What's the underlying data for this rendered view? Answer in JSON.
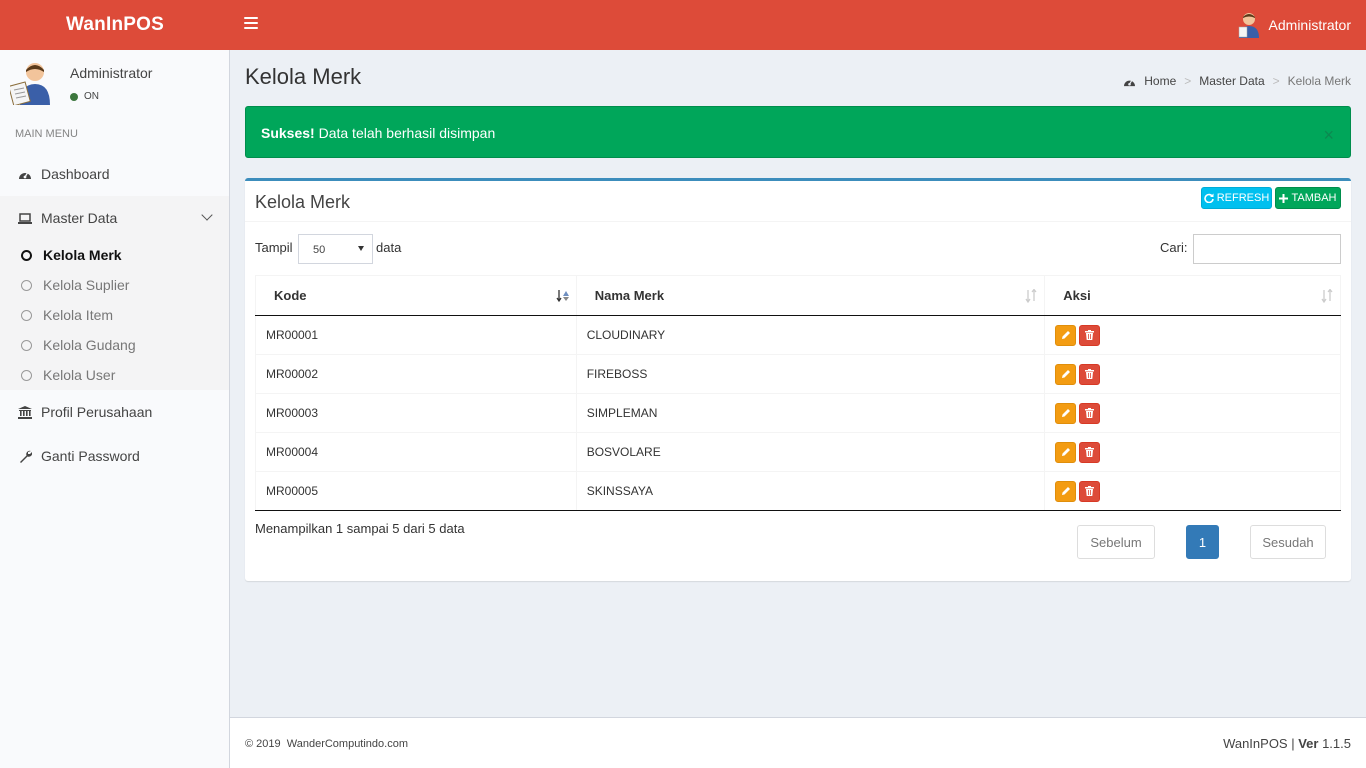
{
  "app": {
    "name": "WanInPOS"
  },
  "topbar": {
    "user_name": "Administrator"
  },
  "sidebar": {
    "user_name": "Administrator",
    "status": "ON",
    "menu_header": "MAIN MENU",
    "items": [
      {
        "label": "Dashboard",
        "icon": "dashboard-icon"
      },
      {
        "label": "Master Data",
        "icon": "laptop-icon"
      },
      {
        "label": "Profil Perusahaan",
        "icon": "bank-icon"
      },
      {
        "label": "Ganti Password",
        "icon": "wrench-icon"
      }
    ],
    "submenu": [
      {
        "label": "Kelola Merk",
        "current": true
      },
      {
        "label": "Kelola Suplier",
        "current": false
      },
      {
        "label": "Kelola Item",
        "current": false
      },
      {
        "label": "Kelola Gudang",
        "current": false
      },
      {
        "label": "Kelola User",
        "current": false
      }
    ]
  },
  "page": {
    "title": "Kelola Merk",
    "breadcrumb": [
      "Home",
      "Master Data",
      "Kelola Merk"
    ]
  },
  "alert": {
    "strong": "Sukses!",
    "message": "Data telah berhasil disimpan",
    "close": "×"
  },
  "box": {
    "title": "Kelola Merk",
    "refresh_label": "REFRESH",
    "add_label": "TAMBAH",
    "length_label": "Tampil",
    "length_value": "50",
    "length_suffix": "data",
    "search_label": "Cari:",
    "search_value": ""
  },
  "table": {
    "columns": [
      "Kode",
      "Nama Merk",
      "Aksi"
    ],
    "rows": [
      {
        "kode": "MR00001",
        "nama": "CLOUDINARY"
      },
      {
        "kode": "MR00002",
        "nama": "FIREBOSS"
      },
      {
        "kode": "MR00003",
        "nama": "SIMPLEMAN"
      },
      {
        "kode": "MR00004",
        "nama": "BOSVOLARE"
      },
      {
        "kode": "MR00005",
        "nama": "SKINSSAYA"
      }
    ],
    "info": "Menampilkan 1 sampai 5 dari 5 data"
  },
  "pagination": {
    "prev": "Sebelum",
    "current": "1",
    "next": "Sesudah"
  },
  "footer": {
    "copyright": "© 2019  WanderComputindo.com",
    "app": "WanInPOS | ",
    "ver_label": "Ver",
    "ver_value": " 1.1.5"
  },
  "colors": {
    "header": "#dd4b39",
    "success": "#00a65a",
    "info": "#00c0ef",
    "primary": "#3c8dbc",
    "warning": "#f39c12"
  }
}
